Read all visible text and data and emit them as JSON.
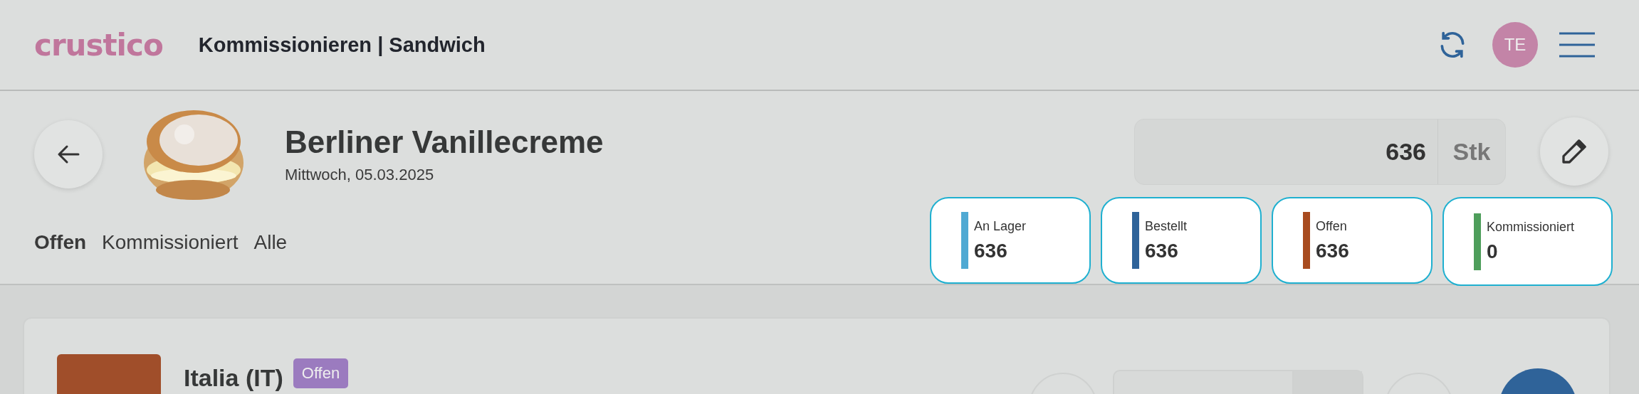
{
  "header": {
    "logo": "crustico",
    "title": "Kommissionieren | Sandwich",
    "avatar": "TE"
  },
  "product": {
    "name": "Berliner Vanillecreme",
    "date": "Mittwoch, 05.03.2025",
    "quantity": {
      "value": "636",
      "unit": "Stk"
    }
  },
  "tabs": [
    {
      "label": "Offen",
      "selected": true
    },
    {
      "label": "Kommissioniert",
      "selected": false
    },
    {
      "label": "Alle",
      "selected": false
    }
  ],
  "stats": [
    {
      "label": "An Lager",
      "value": "636",
      "color": "#4fa9d3"
    },
    {
      "label": "Bestellt",
      "value": "636",
      "color": "#2f6399"
    },
    {
      "label": "Offen",
      "value": "636",
      "color": "#a84b1f"
    },
    {
      "label": "Kommissioniert",
      "value": "0",
      "color": "#4e9e5b"
    }
  ],
  "orders": [
    {
      "country": "Italia (IT)",
      "status": "Offen",
      "color": "#a04e2a"
    }
  ]
}
